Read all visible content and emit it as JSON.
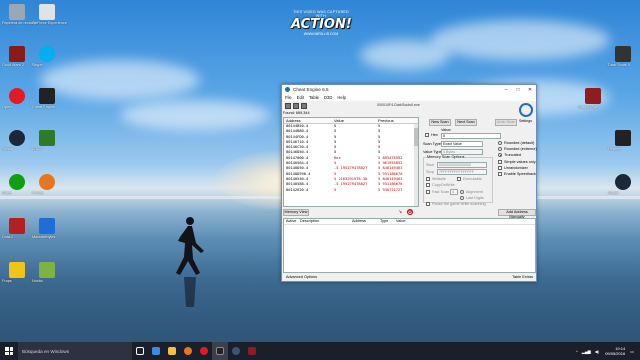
{
  "banner": {
    "top": "THIS VIDEO WAS CAPTURED WITH",
    "big": "ACTION!",
    "url": "WWW.MIRILLIS.COM"
  },
  "desktop_icons": [
    {
      "label": "Papelera de reciclaje",
      "color": "#9aa7b5"
    },
    {
      "label": "GeForce Experience",
      "color": "#dfe3e7"
    },
    {
      "label": "Guild Wars 2",
      "color": "#8a1b1b"
    },
    {
      "label": "Skype",
      "color": "#00aff0"
    },
    {
      "label": "Opera",
      "color": "#e11a26"
    },
    {
      "label": "Cheat Engine",
      "color": "#222222"
    },
    {
      "label": "Steam",
      "color": "#1b2838"
    },
    {
      "label": "GTA V",
      "color": "#2f7a2a"
    },
    {
      "label": "Razer",
      "color": "#0fa00f"
    },
    {
      "label": "Firefox",
      "color": "#e8761e"
    },
    {
      "label": "Dota 2",
      "color": "#b32020"
    },
    {
      "label": "Malwarebytes",
      "color": "#1c6fd6"
    },
    {
      "label": "Fraps",
      "color": "#f0c419"
    },
    {
      "label": "Nvidia",
      "color": "#7cb342"
    },
    {
      "label": "Dark Souls II",
      "color": "#333333"
    },
    {
      "label": "Steam",
      "color": "#1b2838"
    },
    {
      "label": "Dragon Age",
      "color": "#8e1d1d"
    },
    {
      "label": "Heroes",
      "color": "#222222"
    }
  ],
  "window": {
    "title": "Cheat Engine 6.5",
    "menu": [
      "File",
      "Edit",
      "Table",
      "D3D",
      "Help"
    ],
    "process": "000010F4-DarkSoulsII.exe",
    "found": "Found: 669,344",
    "columns": [
      "Address",
      "Value",
      "Previous"
    ],
    "rows": [
      {
        "addr": "00144B50-4",
        "val": "5",
        "prev": "5",
        "red": false
      },
      {
        "addr": "00144B80-4",
        "val": "5",
        "prev": "5",
        "red": false
      },
      {
        "addr": "00144FD0-4",
        "val": "5",
        "prev": "5",
        "red": false
      },
      {
        "addr": "00146710-4",
        "val": "5",
        "prev": "5",
        "red": false
      },
      {
        "addr": "00146C50-4",
        "val": "5",
        "prev": "5",
        "red": false
      },
      {
        "addr": "00146D50-4",
        "val": "5",
        "prev": "5",
        "red": false
      },
      {
        "addr": "00147000-4",
        "val": "Hex",
        "prev": "5 895476592",
        "red": true
      },
      {
        "addr": "00140564-4",
        "val": "5",
        "prev": "5 961955852",
        "red": true
      },
      {
        "addr": "00140D50-4",
        "val": "-5 195279478827",
        "prev": "5 840149463",
        "red": true
      },
      {
        "addr": "00140D590-4",
        "val": "5",
        "prev": "5 931186676",
        "red": true
      },
      {
        "addr": "00140540-4",
        "val": "5 2163291578-30",
        "prev": "5 840149463",
        "red": true
      },
      {
        "addr": "00140588-4",
        "val": "-5 195279478827",
        "prev": "5 931186676",
        "red": true
      },
      {
        "addr": "00142620-4",
        "val": "5",
        "prev": "5 930721727",
        "red": true
      }
    ],
    "buttons": {
      "new_scan": "New Scan",
      "next_scan": "Next Scan",
      "undo_scan": "Undo Scan",
      "memory_view": "Memory View",
      "add_address": "Add Address Manually"
    },
    "settings_label": "Settings",
    "value_label": "Value:",
    "hex_label": "Hex",
    "value_input": "5",
    "scan_type_label": "Scan Type",
    "scan_type_value": "Exact Value",
    "value_type_label": "Value Type",
    "value_type_value": "4 Bytes",
    "mem_options_label": "Memory Scan Options",
    "start_label": "Start",
    "start_value": "0000000000000000",
    "stop_label": "Stop",
    "stop_value": "7FFFFFFFFFFFFFFF",
    "writable": "Writable",
    "executable": "Executable",
    "copyonwrite": "CopyOnWrite",
    "fastscan": "Fast Scan",
    "fastscan_value": "4",
    "alignment": "Alignment",
    "lastdigits": "Last Digits",
    "pause_game": "Pause the game while scanning",
    "rounded_default": "Rounded (default)",
    "rounded_extreme": "Rounded (extreme)",
    "truncated": "Truncated",
    "simple_values": "Simple values only",
    "unrandomizer": "Unrandomizer",
    "speedhack": "Enable Speedhack",
    "addr_columns": [
      "Active",
      "Description",
      "Address",
      "Type",
      "Value"
    ],
    "advanced": "Advanced Options",
    "table_extras": "Table Extras"
  },
  "taskbar": {
    "search": "Búsqueda en Windows",
    "time": "19:14",
    "date": "09/05/2016"
  }
}
